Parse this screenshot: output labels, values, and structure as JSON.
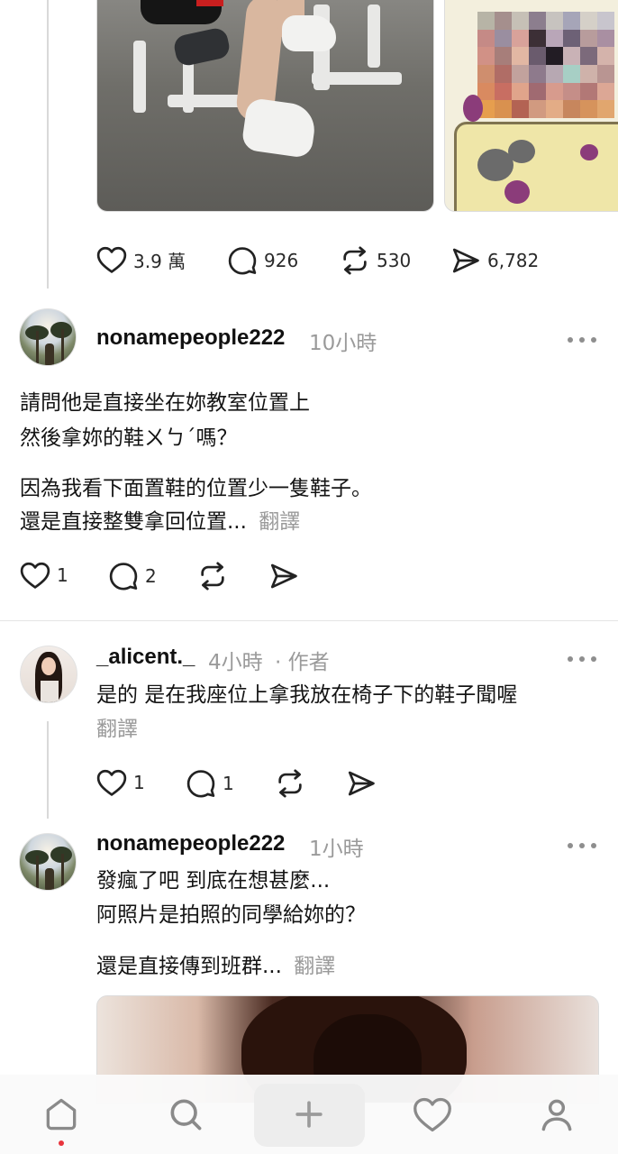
{
  "top_post": {
    "stats": {
      "likes": "3.9 萬",
      "comments": "926",
      "reposts": "530",
      "shares": "6,782"
    }
  },
  "replies": [
    {
      "username": "nonamepeople222",
      "time": "10小時",
      "lines": [
        "請問他是直接坐在妳教室位置上",
        "然後拿妳的鞋ㄨㄅˊ嗎？"
      ],
      "paragraph2": [
        "因為我看下面置鞋的位置少一隻鞋子。",
        "還是直接整雙拿回位置..."
      ],
      "translate": "翻譯",
      "likes": "1",
      "comments": "2"
    },
    {
      "username": "_alicent._",
      "time": "4小時",
      "author_badge": "· 作者",
      "lines": [
        "是的 是在我座位上拿我放在椅子下的鞋子聞喔"
      ],
      "translate": "翻譯",
      "likes": "1",
      "comments": "1"
    },
    {
      "username": "nonamepeople222",
      "time": "1小時",
      "lines": [
        "發瘋了吧 到底在想甚麼...",
        "阿照片是拍照的同學給妳的？"
      ],
      "paragraph2": [
        "還是直接傳到班群..."
      ],
      "translate": "翻譯"
    }
  ],
  "nav": [
    "home-icon",
    "search-icon",
    "compose-icon",
    "activity-icon",
    "profile-icon"
  ],
  "colors": {
    "notification_dot": "#e8343c",
    "meta_gray": "#9a9a9a",
    "thread_line": "#d9d9d9"
  }
}
